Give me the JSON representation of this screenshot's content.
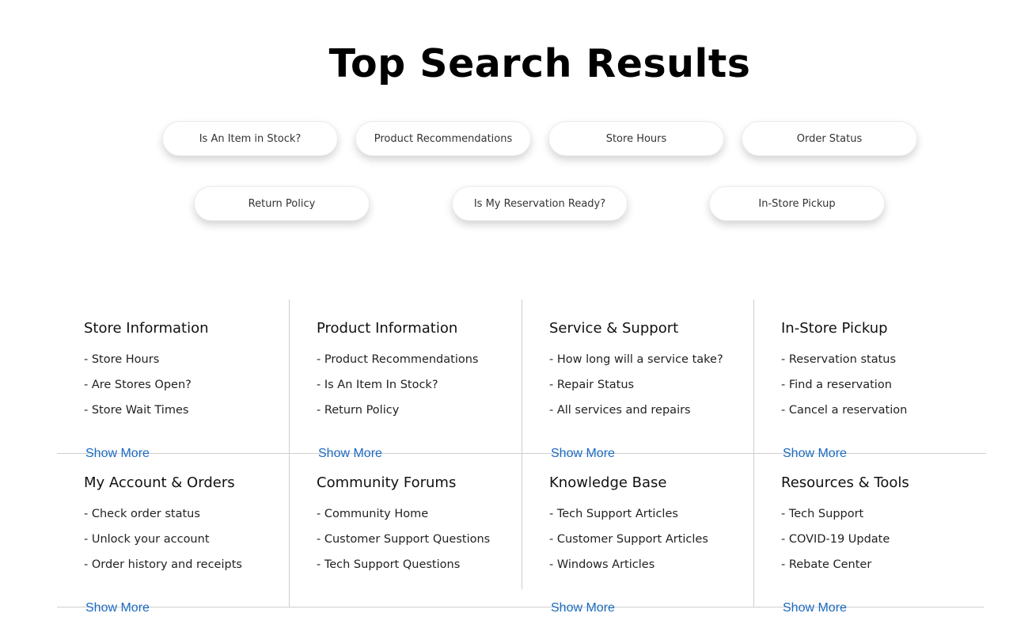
{
  "page_title": "Top Search Results",
  "pills_row1": [
    {
      "label": "Is An Item in Stock?"
    },
    {
      "label": "Product Recommendations"
    },
    {
      "label": "Store Hours"
    },
    {
      "label": "Order Status"
    }
  ],
  "pills_row2": [
    {
      "label": "Return Policy"
    },
    {
      "label": "Is My Reservation Ready?"
    },
    {
      "label": "In-Store Pickup"
    }
  ],
  "categories": [
    {
      "title": "Store Information",
      "links": [
        "- Store Hours",
        "- Are Stores Open?",
        "- Store Wait Times"
      ],
      "show_more": "Show More"
    },
    {
      "title": "Product Information",
      "links": [
        "- Product Recommendations",
        "- Is An Item In Stock?",
        "- Return Policy"
      ],
      "show_more": "Show More"
    },
    {
      "title": "Service & Support",
      "links": [
        "- How long will a service take?",
        "- Repair Status",
        "- All services and repairs"
      ],
      "show_more": "Show More"
    },
    {
      "title": "In-Store Pickup",
      "links": [
        "- Reservation status",
        "- Find a reservation",
        "- Cancel a reservation"
      ],
      "show_more": "Show More"
    },
    {
      "title": "My Account & Orders",
      "links": [
        "- Check order status",
        "- Unlock your account",
        "- Order history and receipts"
      ],
      "show_more": "Show More"
    },
    {
      "title": "Community Forums",
      "links": [
        "- Community Home",
        "- Customer Support Questions",
        "- Tech Support Questions"
      ],
      "show_more": ""
    },
    {
      "title": "Knowledge Base",
      "links": [
        "- Tech Support Articles",
        "- Customer Support Articles",
        "- Windows Articles"
      ],
      "show_more": "Show More"
    },
    {
      "title": "Resources & Tools",
      "links": [
        "- Tech Support",
        "- COVID-19 Update",
        "- Rebate Center"
      ],
      "show_more": "Show More"
    }
  ],
  "colors": {
    "link": "#1b6ac1",
    "divider": "#cfcfcf",
    "title": "#000000"
  }
}
